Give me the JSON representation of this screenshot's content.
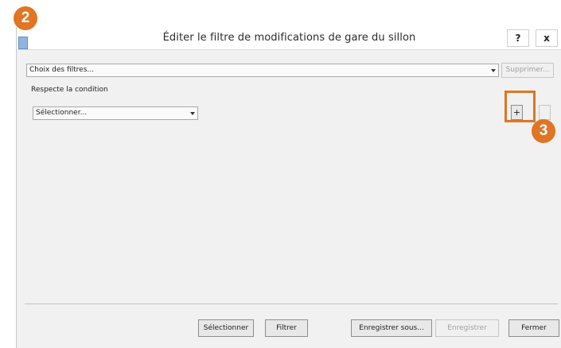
{
  "dialog": {
    "title": "Éditer le filtre de modifications de gare du sillon",
    "help_label": "?",
    "close_label": "x"
  },
  "filters": {
    "selected": "Choix des filtres...",
    "delete_label": "Supprimer..."
  },
  "condition": {
    "label": "Respecte la condition",
    "select_value": "Sélectionner...",
    "add_label": "+",
    "remove_label": ""
  },
  "footer": {
    "select_label": "Sélectionner",
    "filter_label": "Filtrer",
    "save_as_label": "Enregistrer sous...",
    "save_label": "Enregistrer",
    "close_label": "Fermer"
  },
  "callouts": {
    "step_2": "2",
    "step_3": "3"
  },
  "colors": {
    "callout": "#e07524",
    "dialog_background": "#f1f1f1"
  }
}
